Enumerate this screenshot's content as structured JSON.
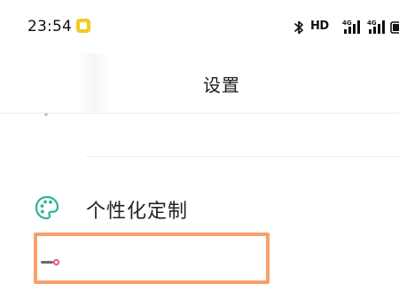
{
  "status_bar": {
    "time": "23:54",
    "notification_icon": "notes-app-icon",
    "bluetooth_icon": "bluetooth-icon",
    "hd_label": "HD",
    "signal_icons": [
      "signal-4g-icon",
      "signal-4g-icon"
    ],
    "battery_icon": "battery-icon"
  },
  "header": {
    "title": "设置"
  },
  "settings_list": {
    "items": [
      {
        "label": "个性化定制",
        "icon": "palette-icon"
      },
      {
        "label": "",
        "icon": "app-icon"
      }
    ]
  },
  "colors": {
    "accent_teal": "#2bb39a",
    "highlight_orange": "#f7a06a",
    "notification_yellow": "#f3cc21"
  }
}
